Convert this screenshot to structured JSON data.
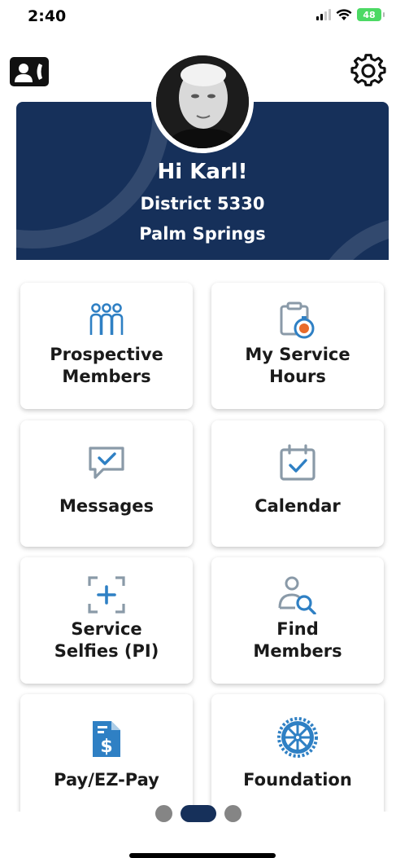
{
  "status": {
    "time": "2:40",
    "battery": "48"
  },
  "header": {
    "contacts_icon": "contact-card-icon",
    "settings_icon": "gear-icon"
  },
  "banner": {
    "greeting": "Hi Karl!",
    "district": "District 5330",
    "club": "Palm Springs",
    "color": "#16305a"
  },
  "tiles": [
    {
      "label_line1": "Prospective",
      "label_line2": "Members",
      "icon": "people-group-icon"
    },
    {
      "label_line1": "My Service",
      "label_line2": "Hours",
      "icon": "clipboard-timer-icon"
    },
    {
      "label_line1": "Messages",
      "icon": "chat-check-icon"
    },
    {
      "label_line1": "Calendar",
      "icon": "calendar-check-icon"
    },
    {
      "label_line1": "Service",
      "label_line2": "Selfies (PI)",
      "icon": "camera-frame-plus-icon"
    },
    {
      "label_line1": "Find",
      "label_line2": "Members",
      "icon": "person-search-icon"
    },
    {
      "label_line1": "Pay/EZ-Pay",
      "icon": "dollar-document-icon"
    },
    {
      "label_line1": "Foundation",
      "icon": "rotary-wheel-icon"
    }
  ],
  "pager": {
    "total": 3,
    "active_index": 1
  },
  "colors": {
    "accent_blue": "#2f80c4",
    "navy": "#16305a",
    "icon_grey": "#8a9aa8",
    "timer_orange": "#e86a2a"
  }
}
